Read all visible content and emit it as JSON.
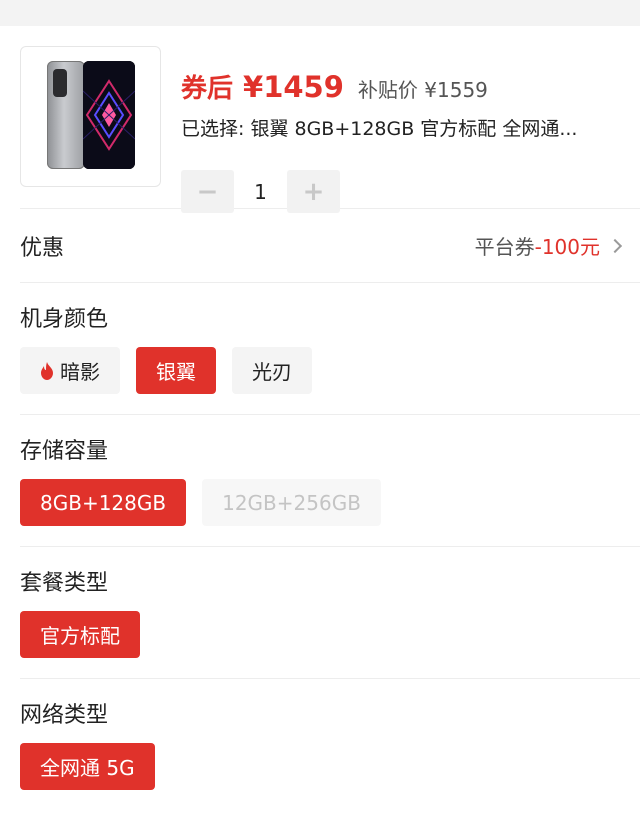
{
  "product": {
    "price_prefix": "券后",
    "price": "¥1459",
    "subsidy_price": "补贴价 ¥1559",
    "selected_summary": "已选择: 银翼 8GB+128GB 官方标配 全网通...",
    "quantity": "1",
    "decrease_label": "−",
    "increase_label": "+"
  },
  "coupon": {
    "label": "优惠",
    "platform_text": "平台券",
    "amount": "-100元"
  },
  "sections": [
    {
      "title": "机身颜色",
      "options": [
        {
          "label": "暗影",
          "state": "normal",
          "icon": "flame-icon"
        },
        {
          "label": "银翼",
          "state": "selected"
        },
        {
          "label": "光刃",
          "state": "normal"
        }
      ]
    },
    {
      "title": "存储容量",
      "options": [
        {
          "label": "8GB+128GB",
          "state": "selected"
        },
        {
          "label": "12GB+256GB",
          "state": "disabled"
        }
      ]
    },
    {
      "title": "套餐类型",
      "options": [
        {
          "label": "官方标配",
          "state": "selected"
        }
      ]
    },
    {
      "title": "网络类型",
      "options": [
        {
          "label": "全网通 5G",
          "state": "selected"
        }
      ]
    }
  ],
  "colors": {
    "accent": "#e0322b",
    "chip_bg": "#f4f4f4",
    "divider": "#ededed"
  }
}
